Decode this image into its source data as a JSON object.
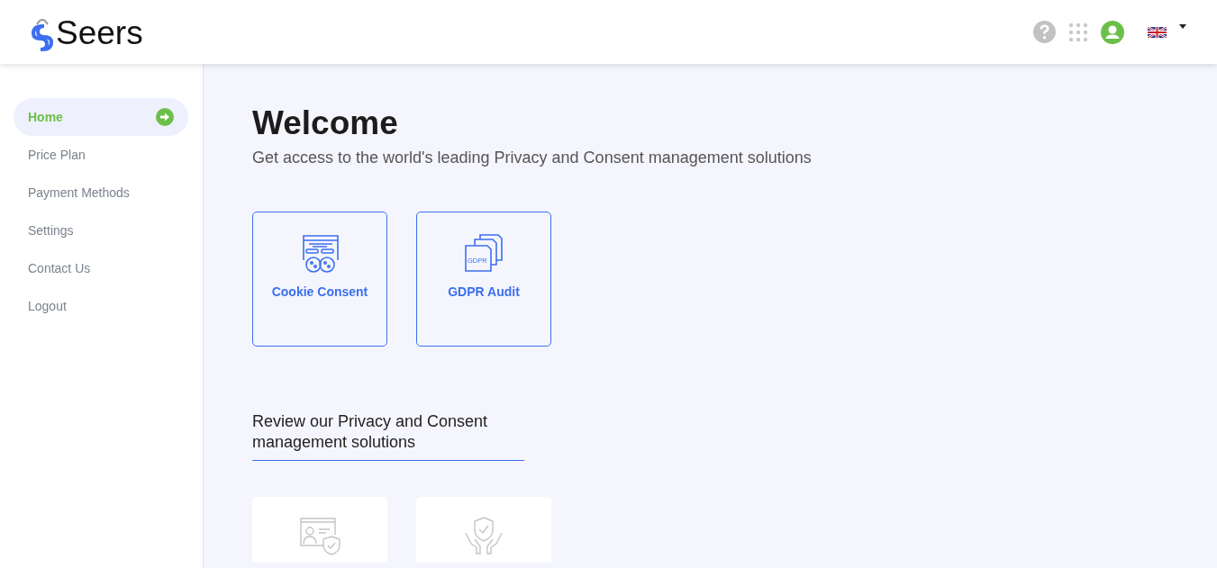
{
  "header": {
    "logo": "Seers"
  },
  "sidebar": {
    "items": [
      {
        "label": "Home",
        "selected": true
      },
      {
        "label": "Price Plan",
        "selected": false
      },
      {
        "label": "Payment Methods",
        "selected": false
      },
      {
        "label": "Settings",
        "selected": false
      },
      {
        "label": "Contact Us",
        "selected": false
      },
      {
        "label": "Logout",
        "selected": false
      }
    ]
  },
  "main": {
    "title": "Welcome",
    "subtitle": "Get access to the world's leading Privacy and Consent management solutions",
    "products": [
      {
        "label": "Cookie Consent"
      },
      {
        "label": "GDPR Audit",
        "icon_text": "GDPR"
      }
    ],
    "review_heading": "Review our Privacy and Consent management solutions"
  }
}
